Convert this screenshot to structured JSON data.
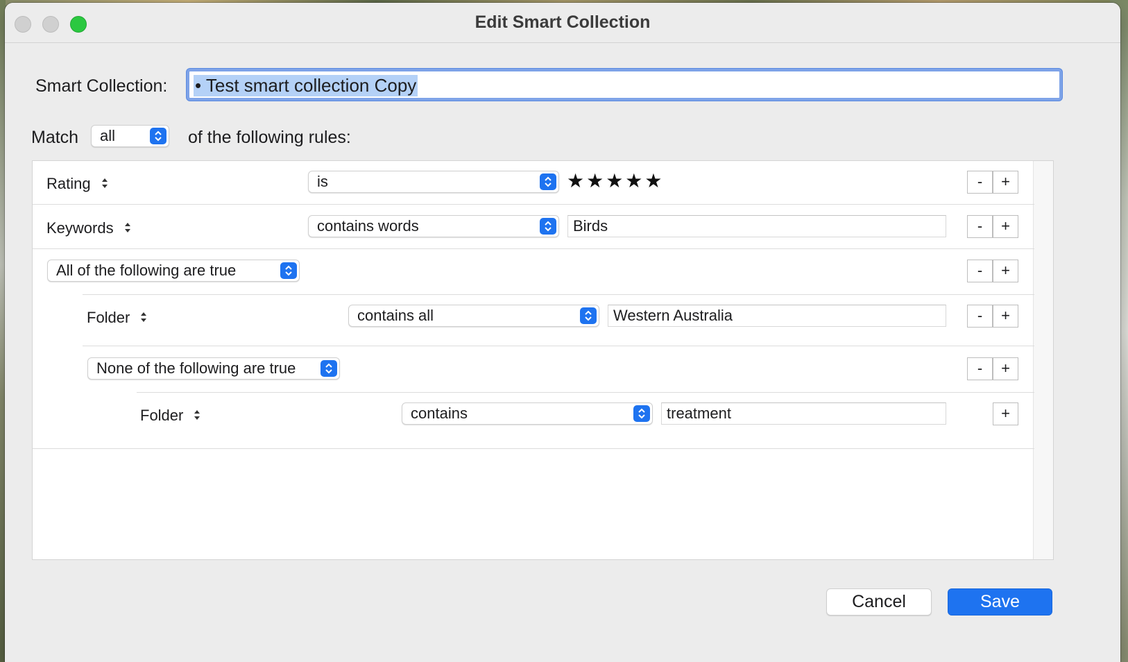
{
  "window": {
    "title": "Edit Smart Collection"
  },
  "name": {
    "label": "Smart Collection:",
    "value": "• Test smart collection  Copy"
  },
  "match": {
    "label": "Match",
    "value": "all",
    "tail": "of the following rules:"
  },
  "rules": {
    "rating": {
      "field": "Rating",
      "operator": "is",
      "stars": "★★★★★",
      "stars_count": 5
    },
    "keywords": {
      "field": "Keywords",
      "operator": "contains words",
      "value": "Birds"
    },
    "group_all": {
      "label": "All of the following are true"
    },
    "folder1": {
      "field": "Folder",
      "operator": "contains all",
      "value": "Western Australia"
    },
    "group_none": {
      "label": "None of the following are true"
    },
    "folder2": {
      "field": "Folder",
      "operator": "contains",
      "value": "treatment"
    }
  },
  "controls": {
    "minus": "-",
    "plus": "+"
  },
  "buttons": {
    "cancel": "Cancel",
    "save": "Save"
  },
  "colors": {
    "accent": "#1e73f0",
    "zoom": "#2bc840",
    "selection": "#b4d1f7"
  }
}
